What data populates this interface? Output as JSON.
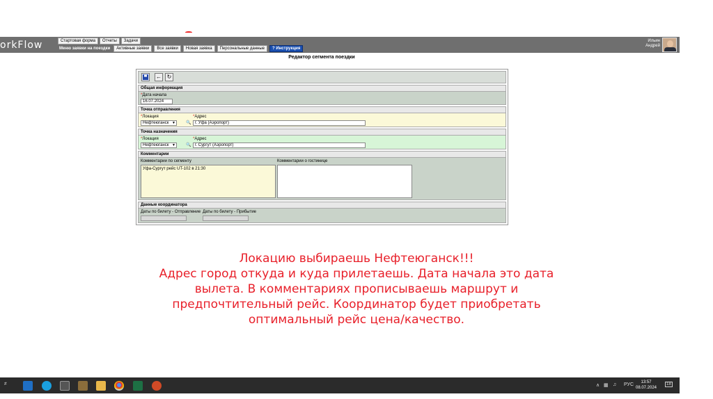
{
  "app": {
    "logo": "orkFlow",
    "menu_top": [
      "Стартовая форма",
      "Отчеты",
      "Задачи"
    ],
    "menu_current": "Меню заявки на поездки",
    "menu_tabs": [
      "Активные заявки",
      "Все заявки",
      "Новая заявка",
      "Персональные данные"
    ],
    "help_label": "Инструкция",
    "user_first": "Ильин",
    "user_last": "Андрей"
  },
  "page_title": "Редактор сегмента поездки",
  "toolbar": {
    "save_icon": "save-icon",
    "back_icon": "back-arrow-icon",
    "refresh_icon": "refresh-icon"
  },
  "general": {
    "header": "Общая информация",
    "start_date_label": "Дата начала",
    "start_date_value": "16.07.2024"
  },
  "departure": {
    "header": "Точка отправления",
    "location_label": "Локация",
    "location_value": "Нефтеюганск",
    "address_label": "Адрес",
    "address_value": "г. Уфа (Аэропорт)"
  },
  "destination": {
    "header": "Точка назначения",
    "location_label": "Локация",
    "location_value": "Нефтеюганск",
    "address_label": "Адрес",
    "address_value": "г. Сургут (Аэропорт)"
  },
  "comments": {
    "header": "Комментарии",
    "segment_label": "Комментарии по сегменту",
    "segment_value": "Уфа-Сургут рейс UT-102 в 21:30",
    "hotel_label": "Комментарии о гостинице",
    "hotel_value": ""
  },
  "coordinator": {
    "header": "Данные координатора",
    "depart_label": "Даты по билету - Отправление",
    "arrive_label": "Даты по билету - Прибытие"
  },
  "note": {
    "line1": "Локацию выбираешь Нефтеюганск!!!",
    "line2": "Адрес город откуда и куда прилетаешь. Дата начала это дата",
    "line3": "вылета. В комментариях прописываешь маршрут и",
    "line4": "предпочтительный рейс. Координатор будет приобретать",
    "line5": "оптимальный рейс цена/качество."
  },
  "taskbar": {
    "lang": "РУС",
    "time": "13:57",
    "date": "08.07.2024",
    "notif_count": "18"
  },
  "colors": {
    "header_bar": "#6f6f6f",
    "section_gray": "#c9d3c9",
    "section_yellow": "#fbf9d8",
    "section_green": "#d7f5d7",
    "note_red": "#e8202a",
    "taskbar": "#2b2b2b"
  }
}
